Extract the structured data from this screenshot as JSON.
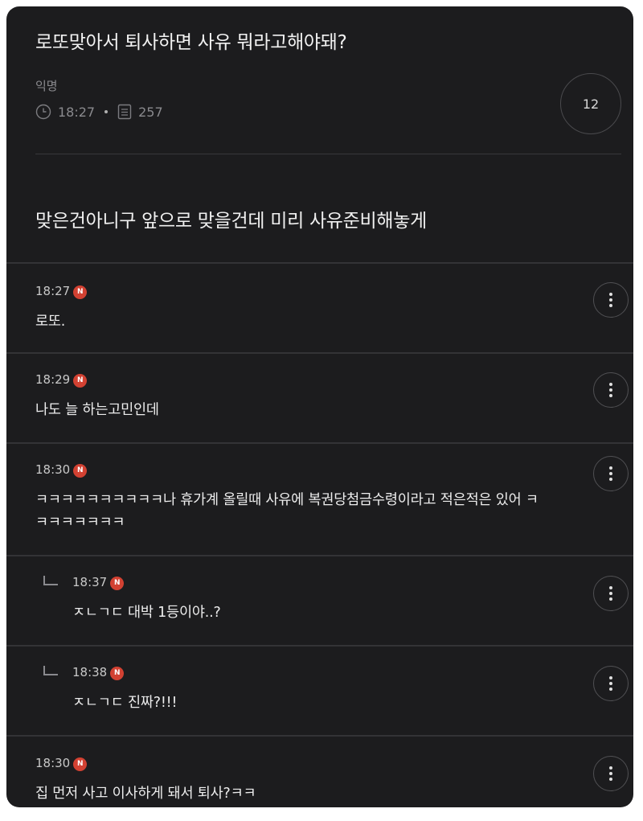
{
  "post": {
    "title": "로또맞아서 퇴사하면 사유 뭐라고해야돼?",
    "author": "익명",
    "time": "18:27",
    "views": "257",
    "comment_count": "12",
    "body": "맞은건아니구 앞으로 맞을건데 미리 사유준비해놓게"
  },
  "comments": [
    {
      "time": "18:27",
      "badge": "N",
      "text": "로또.",
      "reply": false
    },
    {
      "time": "18:29",
      "badge": "N",
      "text": "나도 늘 하는고민인데",
      "reply": false
    },
    {
      "time": "18:30",
      "badge": "N",
      "text": "ㅋㅋㅋㅋㅋㅋㅋㅋㅋㅋ나 휴가계 올릴때 사유에 복권당첨금수령이라고 적은적은 있어 ㅋㅋㅋㅋㅋㅋㅋㅋ",
      "reply": false
    },
    {
      "time": "18:37",
      "badge": "N",
      "text": "ㅈㄴㄱㄷ 대박 1등이야..?",
      "reply": true
    },
    {
      "time": "18:38",
      "badge": "N",
      "text": "ㅈㄴㄱㄷ 진짜?!!!",
      "reply": true
    },
    {
      "time": "18:30",
      "badge": "N",
      "text": "집 먼저 사고 이사하게 돼서 퇴사?ㅋㅋ",
      "reply": false
    }
  ],
  "icons": {
    "clock": "clock-icon",
    "views": "document-icon",
    "more": "more-vertical-icon",
    "reply": "reply-arrow-icon"
  },
  "colors": {
    "background": "#1c1c1e",
    "new_badge": "#d24132"
  }
}
